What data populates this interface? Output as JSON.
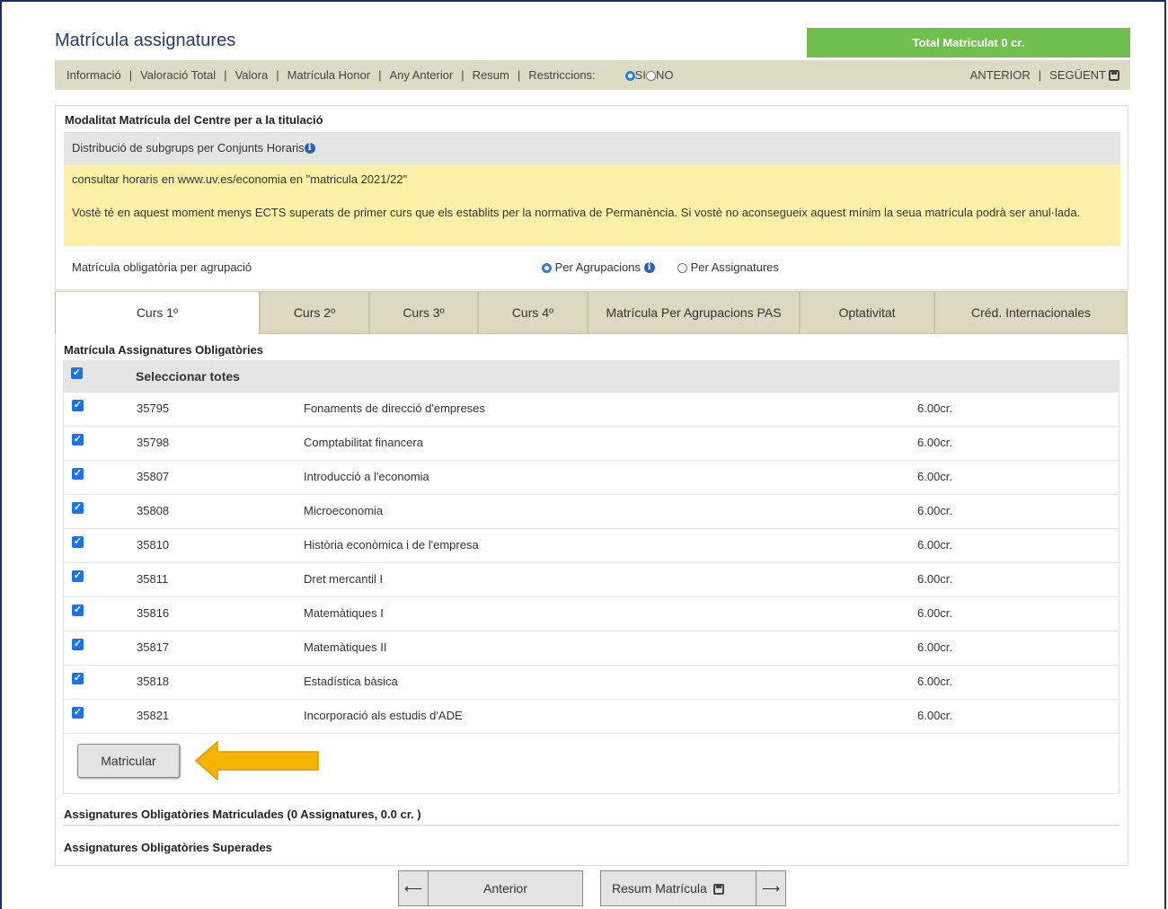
{
  "header": {
    "title": "Matrícula assignatures",
    "total": "Total Matriculat 0 cr."
  },
  "nav": {
    "items": [
      "Informació",
      "Valoració Total",
      "Valora",
      "Matrícula Honor",
      "Any Anterior",
      "Resum"
    ],
    "restrictions_label": "Restriccions:",
    "si": "SI",
    "no": "NO",
    "anterior": "ANTERIOR",
    "seguent": "SEGÜENT"
  },
  "panel": {
    "title": "Modalitat Matrícula del Centre per a la titulació",
    "subgroups": "Distribució de subgrups per Conjunts Horaris",
    "notice_hours": "consultar horaris en www.uv.es/economia en \"matricula 2021/22\"",
    "notice_ects": "Vostè té en aquest moment menys ECTS superats de primer curs que els establits per la normativa de Permanència. Si vostè no aconsegueix aquest mínim la seua matrícula podrà ser anul·lada.",
    "obligatory_label": "Matrícula obligatòria per agrupació",
    "option_groups": "Per Agrupacions",
    "option_subjects": "Per Assignatures"
  },
  "tabs": [
    "Curs 1º",
    "Curs 2º",
    "Curs 3º",
    "Curs 4º",
    "Matrícula Per Agrupacions PAS",
    "Optativitat",
    "Créd. Internacionales"
  ],
  "content": {
    "section_title": "Matrícula Assignatures Obligatòries",
    "select_all": "Seleccionar totes",
    "subjects": [
      {
        "code": "35795",
        "name": "Fonaments de direcció d'empreses",
        "credits": "6.00cr."
      },
      {
        "code": "35798",
        "name": "Comptabilitat financera",
        "credits": "6.00cr."
      },
      {
        "code": "35807",
        "name": "Introducció a l'economia",
        "credits": "6.00cr."
      },
      {
        "code": "35808",
        "name": "Microeconomia",
        "credits": "6.00cr."
      },
      {
        "code": "35810",
        "name": "Història econòmica i de l'empresa",
        "credits": "6.00cr."
      },
      {
        "code": "35811",
        "name": "Dret mercantil I",
        "credits": "6.00cr."
      },
      {
        "code": "35816",
        "name": "Matemàtiques I",
        "credits": "6.00cr."
      },
      {
        "code": "35817",
        "name": "Matemàtiques II",
        "credits": "6.00cr."
      },
      {
        "code": "35818",
        "name": "Estadística bàsica",
        "credits": "6.00cr."
      },
      {
        "code": "35821",
        "name": "Incorporació als estudis d'ADE",
        "credits": "6.00cr."
      }
    ],
    "matricular": "Matricular",
    "enrolled_title": "Assignatures Obligatòries Matriculades (0 Assignatures, 0.0 cr. )",
    "passed_title": "Assignatures Obligatòries Superades"
  },
  "footer": {
    "anterior": "Anterior",
    "resum": "Resum Matrícula"
  },
  "colors": {
    "accent_green": "#6fbf4f",
    "navbar": "#dcdcc4",
    "notice_yellow": "#fdf1a7",
    "arrow": "#f5b400"
  }
}
